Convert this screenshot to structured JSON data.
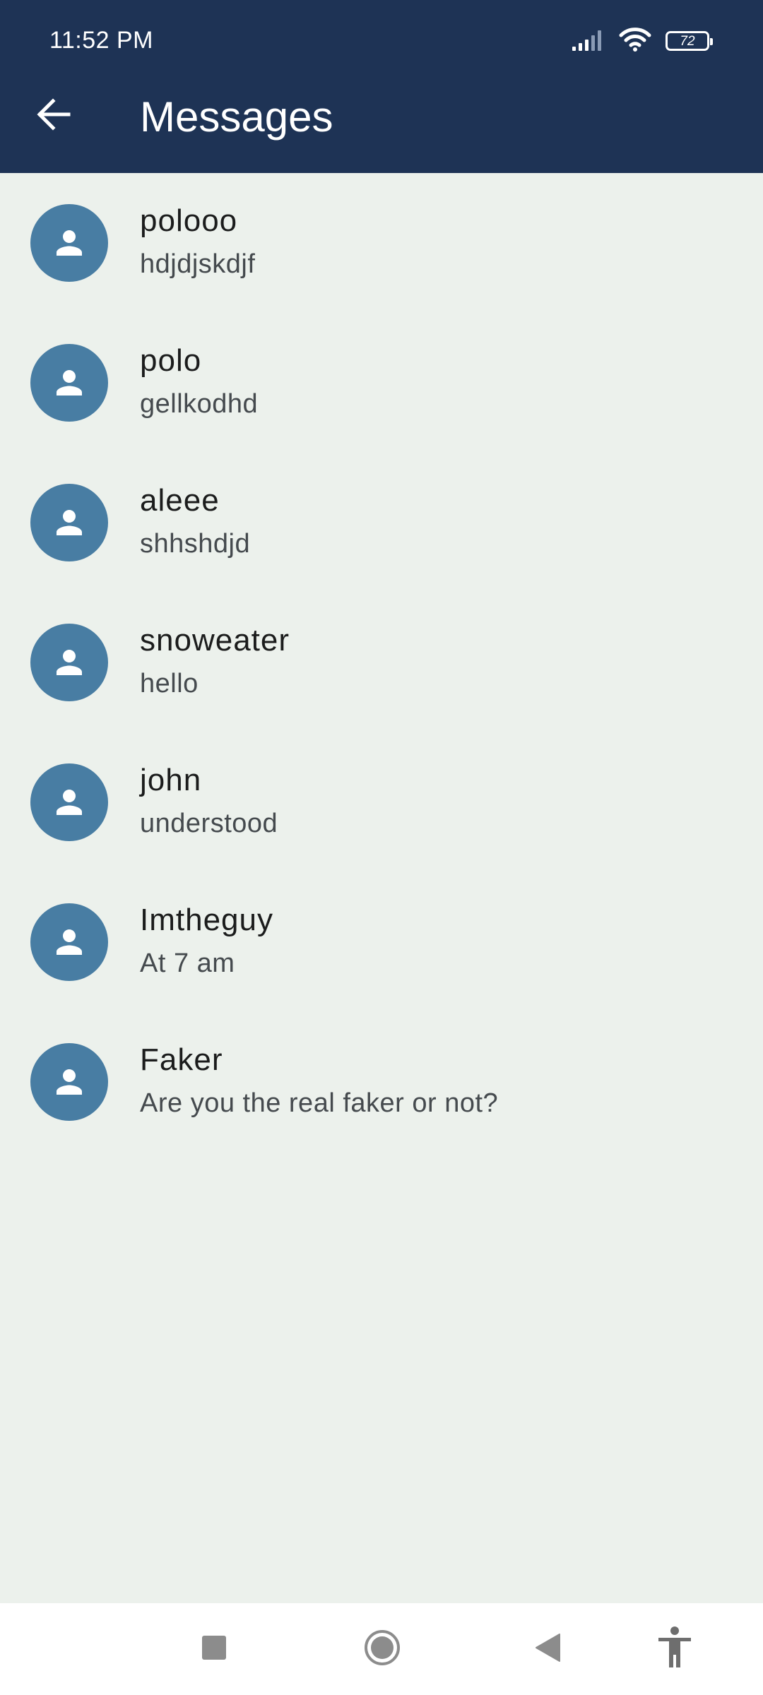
{
  "status_bar": {
    "time": "11:52 PM",
    "battery_level": "72",
    "icons": [
      "signal-icon",
      "wifi-icon",
      "battery-icon"
    ]
  },
  "app_bar": {
    "title": "Messages",
    "back_icon": "arrow-back-icon"
  },
  "conversations": [
    {
      "name": "polooo",
      "preview": "hdjdjskdjf"
    },
    {
      "name": "polo",
      "preview": "gellkodhd"
    },
    {
      "name": "aleee",
      "preview": "shhshdjd"
    },
    {
      "name": "snoweater",
      "preview": "hello"
    },
    {
      "name": "john",
      "preview": "understood"
    },
    {
      "name": "Imtheguy",
      "preview": "At 7 am"
    },
    {
      "name": "Faker",
      "preview": "Are you the real faker or not?"
    }
  ],
  "nav_bar": {
    "icons": [
      "recents-icon",
      "home-icon",
      "back-icon",
      "accessibility-icon"
    ]
  },
  "colors": {
    "app_bar": "#1E3355",
    "background": "#ECF1EC",
    "avatar": "#487DA3",
    "name_text": "#1B1C1C",
    "preview_text": "#454A4E"
  }
}
